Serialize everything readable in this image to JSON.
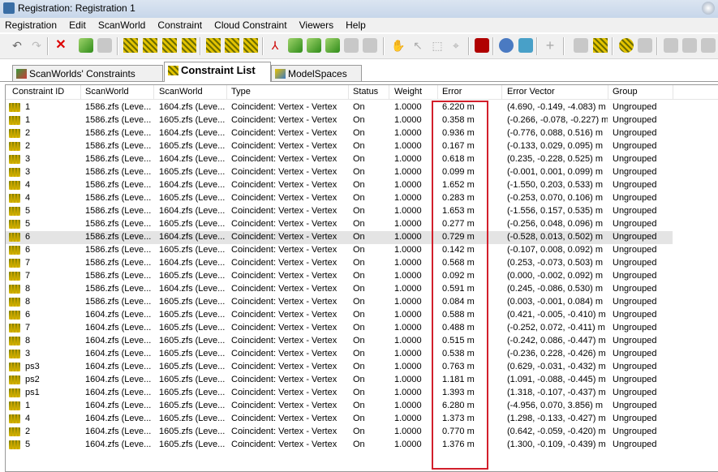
{
  "window": {
    "title": "Registration: Registration 1"
  },
  "menu": [
    "Registration",
    "Edit",
    "ScanWorld",
    "Constraint",
    "Cloud Constraint",
    "Viewers",
    "Help"
  ],
  "toolbar_icons": [
    "undo-icon",
    "redo-icon",
    "delete-icon",
    "add-scanworld-icon",
    "remove-scanworld-icon",
    "constraint-auto-icon",
    "constraint-vertex-icon",
    "constraint-edit-icon",
    "constraint-delete-icon",
    "link-icon",
    "unlink-icon",
    "chart-icon",
    "register-icon",
    "add-constraint-icon",
    "check-icon",
    "check2-icon",
    "disabled-check-icon",
    "disabled-check2-icon",
    "hand-icon",
    "pointer-icon",
    "select-icon",
    "target-icon",
    "lock-icon",
    "globe-icon",
    "cloud-icon",
    "plus-icon",
    "branch-icon",
    "branch2-icon",
    "node-icon",
    "node2-icon",
    "tree-icon",
    "tree2-icon",
    "tree3-icon"
  ],
  "tabs": [
    {
      "label": "ScanWorlds' Constraints",
      "active": false
    },
    {
      "label": "Constraint List",
      "active": true
    },
    {
      "label": "ModelSpaces",
      "active": false
    }
  ],
  "table": {
    "headers": [
      "Constraint ID",
      "ScanWorld",
      "ScanWorld",
      "Type",
      "Status",
      "Weight",
      "Error",
      "Error Vector",
      "Group"
    ],
    "rows": [
      [
        "1",
        "1586.zfs (Leve...",
        "1604.zfs (Leve...",
        "Coincident: Vertex - Vertex",
        "On",
        "1.0000",
        "6.220 m",
        "(4.690, -0.149, -4.083) m",
        "Ungrouped"
      ],
      [
        "1",
        "1586.zfs (Leve...",
        "1605.zfs (Leve...",
        "Coincident: Vertex - Vertex",
        "On",
        "1.0000",
        "0.358 m",
        "(-0.266, -0.078, -0.227) m",
        "Ungrouped"
      ],
      [
        "2",
        "1586.zfs (Leve...",
        "1604.zfs (Leve...",
        "Coincident: Vertex - Vertex",
        "On",
        "1.0000",
        "0.936 m",
        "(-0.776, 0.088, 0.516) m",
        "Ungrouped"
      ],
      [
        "2",
        "1586.zfs (Leve...",
        "1605.zfs (Leve...",
        "Coincident: Vertex - Vertex",
        "On",
        "1.0000",
        "0.167 m",
        "(-0.133, 0.029, 0.095) m",
        "Ungrouped"
      ],
      [
        "3",
        "1586.zfs (Leve...",
        "1604.zfs (Leve...",
        "Coincident: Vertex - Vertex",
        "On",
        "1.0000",
        "0.618 m",
        "(0.235, -0.228, 0.525) m",
        "Ungrouped"
      ],
      [
        "3",
        "1586.zfs (Leve...",
        "1605.zfs (Leve...",
        "Coincident: Vertex - Vertex",
        "On",
        "1.0000",
        "0.099 m",
        "(-0.001, 0.001, 0.099) m",
        "Ungrouped"
      ],
      [
        "4",
        "1586.zfs (Leve...",
        "1604.zfs (Leve...",
        "Coincident: Vertex - Vertex",
        "On",
        "1.0000",
        "1.652 m",
        "(-1.550, 0.203, 0.533) m",
        "Ungrouped"
      ],
      [
        "4",
        "1586.zfs (Leve...",
        "1605.zfs (Leve...",
        "Coincident: Vertex - Vertex",
        "On",
        "1.0000",
        "0.283 m",
        "(-0.253, 0.070, 0.106) m",
        "Ungrouped"
      ],
      [
        "5",
        "1586.zfs (Leve...",
        "1604.zfs (Leve...",
        "Coincident: Vertex - Vertex",
        "On",
        "1.0000",
        "1.653 m",
        "(-1.556, 0.157, 0.535) m",
        "Ungrouped"
      ],
      [
        "5",
        "1586.zfs (Leve...",
        "1605.zfs (Leve...",
        "Coincident: Vertex - Vertex",
        "On",
        "1.0000",
        "0.277 m",
        "(-0.256, 0.048, 0.096) m",
        "Ungrouped"
      ],
      [
        "6",
        "1586.zfs (Leve...",
        "1604.zfs (Leve...",
        "Coincident: Vertex - Vertex",
        "On",
        "1.0000",
        "0.729 m",
        "(-0.528, 0.013, 0.502) m",
        "Ungrouped"
      ],
      [
        "6",
        "1586.zfs (Leve...",
        "1605.zfs (Leve...",
        "Coincident: Vertex - Vertex",
        "On",
        "1.0000",
        "0.142 m",
        "(-0.107, 0.008, 0.092) m",
        "Ungrouped"
      ],
      [
        "7",
        "1586.zfs (Leve...",
        "1604.zfs (Leve...",
        "Coincident: Vertex - Vertex",
        "On",
        "1.0000",
        "0.568 m",
        "(0.253, -0.073, 0.503) m",
        "Ungrouped"
      ],
      [
        "7",
        "1586.zfs (Leve...",
        "1605.zfs (Leve...",
        "Coincident: Vertex - Vertex",
        "On",
        "1.0000",
        "0.092 m",
        "(0.000, -0.002, 0.092) m",
        "Ungrouped"
      ],
      [
        "8",
        "1586.zfs (Leve...",
        "1604.zfs (Leve...",
        "Coincident: Vertex - Vertex",
        "On",
        "1.0000",
        "0.591 m",
        "(0.245, -0.086, 0.530) m",
        "Ungrouped"
      ],
      [
        "8",
        "1586.zfs (Leve...",
        "1605.zfs (Leve...",
        "Coincident: Vertex - Vertex",
        "On",
        "1.0000",
        "0.084 m",
        "(0.003, -0.001, 0.084) m",
        "Ungrouped"
      ],
      [
        "6",
        "1604.zfs (Leve...",
        "1605.zfs (Leve...",
        "Coincident: Vertex - Vertex",
        "On",
        "1.0000",
        "0.588 m",
        "(0.421, -0.005, -0.410) m",
        "Ungrouped"
      ],
      [
        "7",
        "1604.zfs (Leve...",
        "1605.zfs (Leve...",
        "Coincident: Vertex - Vertex",
        "On",
        "1.0000",
        "0.488 m",
        "(-0.252, 0.072, -0.411) m",
        "Ungrouped"
      ],
      [
        "8",
        "1604.zfs (Leve...",
        "1605.zfs (Leve...",
        "Coincident: Vertex - Vertex",
        "On",
        "1.0000",
        "0.515 m",
        "(-0.242, 0.086, -0.447) m",
        "Ungrouped"
      ],
      [
        "3",
        "1604.zfs (Leve...",
        "1605.zfs (Leve...",
        "Coincident: Vertex - Vertex",
        "On",
        "1.0000",
        "0.538 m",
        "(-0.236, 0.228, -0.426) m",
        "Ungrouped"
      ],
      [
        "ps3",
        "1604.zfs (Leve...",
        "1605.zfs (Leve...",
        "Coincident: Vertex - Vertex",
        "On",
        "1.0000",
        "0.763 m",
        "(0.629, -0.031, -0.432) m",
        "Ungrouped"
      ],
      [
        "ps2",
        "1604.zfs (Leve...",
        "1605.zfs (Leve...",
        "Coincident: Vertex - Vertex",
        "On",
        "1.0000",
        "1.181 m",
        "(1.091, -0.088, -0.445) m",
        "Ungrouped"
      ],
      [
        "ps1",
        "1604.zfs (Leve...",
        "1605.zfs (Leve...",
        "Coincident: Vertex - Vertex",
        "On",
        "1.0000",
        "1.393 m",
        "(1.318, -0.107, -0.437) m",
        "Ungrouped"
      ],
      [
        "1",
        "1604.zfs (Leve...",
        "1605.zfs (Leve...",
        "Coincident: Vertex - Vertex",
        "On",
        "1.0000",
        "6.280 m",
        "(-4.956, 0.070, 3.856) m",
        "Ungrouped"
      ],
      [
        "4",
        "1604.zfs (Leve...",
        "1605.zfs (Leve...",
        "Coincident: Vertex - Vertex",
        "On",
        "1.0000",
        "1.373 m",
        "(1.298, -0.133, -0.427) m",
        "Ungrouped"
      ],
      [
        "2",
        "1604.zfs (Leve...",
        "1605.zfs (Leve...",
        "Coincident: Vertex - Vertex",
        "On",
        "1.0000",
        "0.770 m",
        "(0.642, -0.059, -0.420) m",
        "Ungrouped"
      ],
      [
        "5",
        "1604.zfs (Leve...",
        "1605.zfs (Leve...",
        "Coincident: Vertex - Vertex",
        "On",
        "1.0000",
        "1.376 m",
        "(1.300, -0.109, -0.439) m",
        "Ungrouped"
      ]
    ],
    "selected_row": 10
  },
  "colors": {
    "highlight": "#d21f2b",
    "selected_row": "#e4e4e4"
  }
}
